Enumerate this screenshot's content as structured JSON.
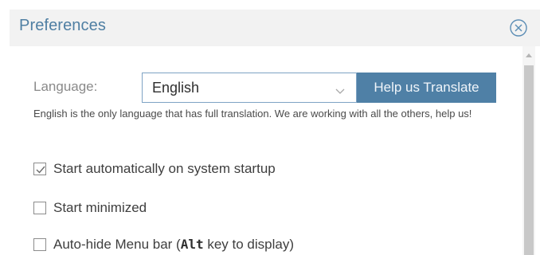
{
  "dialog": {
    "title": "Preferences",
    "close_icon": "close-circle-icon"
  },
  "language": {
    "label": "Language:",
    "selected": "English",
    "dropdown_icon": "chevron-down-icon",
    "help_button": "Help us Translate",
    "note": "English is the only language that has full translation. We are working with all the others, help us!"
  },
  "options": {
    "start_auto": {
      "label": "Start automatically on system startup",
      "checked": true
    },
    "start_min": {
      "label": "Start minimized",
      "checked": false
    },
    "autohide": {
      "label_before": "Auto-hide Menu bar (",
      "key": "Alt",
      "label_after": " key to display)",
      "checked": false
    }
  },
  "colors": {
    "accent": "#4f80a6",
    "title": "#4f7fa3",
    "titlebar_bg": "#f2f2f2"
  }
}
